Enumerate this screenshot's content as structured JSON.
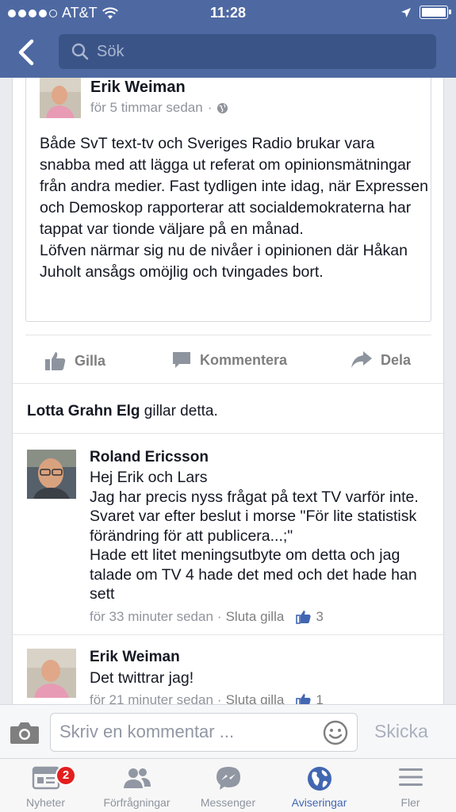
{
  "status_bar": {
    "carrier": "AT&T",
    "time": "11:28"
  },
  "header": {
    "search_placeholder": "Sök"
  },
  "post": {
    "author": "Erik Weiman",
    "timestamp": "för 5 timmar sedan",
    "body": "Både SvT text-tv och Sveriges Radio brukar vara snabba med att lägga ut referat om opinionsmätningar från andra medier. Fast tydligen inte idag, när Expressen och Demoskop rapporterar att socialdemokraterna har tappat var tionde väljare på en månad.\nLöfven närmar sig nu de nivåer i opinionen där Håkan Juholt ansågs omöjlig och tvingades bort."
  },
  "actions": {
    "like": "Gilla",
    "comment": "Kommentera",
    "share": "Dela"
  },
  "likers": {
    "name": "Lotta Grahn Elg",
    "suffix": "gillar detta."
  },
  "comments": [
    {
      "author": "Roland Ericsson",
      "text": "Hej Erik och Lars\nJag har precis nyss frågat på text TV varför inte. Svaret var efter beslut i morse \"För lite statistisk förändring för att publicera...;\"\nHade ett litet meningsutbyte om detta och jag talade om  TV 4 hade det med och det hade han sett",
      "time": "för 33 minuter sedan",
      "action": "Sluta gilla",
      "likes": "3"
    },
    {
      "author": "Erik Weiman",
      "text": "Det twittrar jag!",
      "time": "för 21 minuter sedan",
      "action": "Sluta gilla",
      "likes": "1"
    }
  ],
  "composer": {
    "placeholder": "Skriv en kommentar ...",
    "send": "Skicka"
  },
  "tabs": [
    {
      "label": "Nyheter",
      "badge": "2"
    },
    {
      "label": "Förfrågningar"
    },
    {
      "label": "Messenger"
    },
    {
      "label": "Aviseringar"
    },
    {
      "label": "Fler"
    }
  ],
  "colors": {
    "brand": "#4e69a2",
    "search_bg": "#3b5488",
    "active_tab": "#4267b2",
    "badge": "#e41e1e"
  },
  "icons": [
    "back-chevron-icon",
    "search-icon",
    "globe-icon",
    "like-icon",
    "comment-icon",
    "share-icon",
    "thumbs-up-icon",
    "camera-icon",
    "smiley-icon",
    "news-feed-icon",
    "friends-icon",
    "messenger-icon",
    "globe-icon",
    "menu-icon"
  ]
}
